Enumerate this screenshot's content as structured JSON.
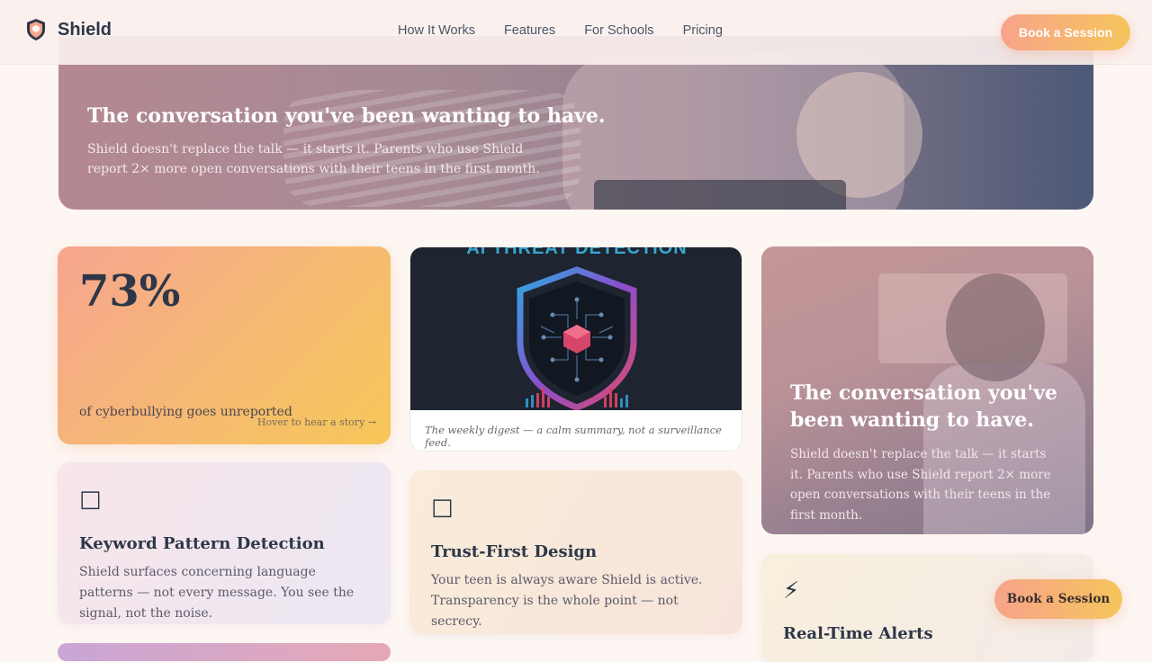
{
  "nav": {
    "brand": "Shield",
    "links": [
      "How It Works",
      "Features",
      "For Schools",
      "Pricing"
    ],
    "cta": "Book a Session"
  },
  "hero": {
    "title": "The conversation you've been wanting to have.",
    "subtitle": "Shield doesn't replace the talk — it starts it. Parents who use Shield report 2× more open conversations with their teens in the first month."
  },
  "stat_card": {
    "value": "73%",
    "label": "of cyberbullying goes unreported",
    "hover_hint": "Hover to hear a story →"
  },
  "image_card": {
    "image_text": "AI THREAT DETECTION",
    "caption": "The weekly digest — a calm summary, not a surveillance feed."
  },
  "photo_card": {
    "title": "The conversation you've been wanting to have.",
    "subtitle": "Shield doesn't replace the talk — it starts it. Parents who use Shield report 2× more open conversations with their teens in the first month."
  },
  "features": [
    {
      "icon": "missing-glyph-icon",
      "glyph": "□",
      "title": "Keyword Pattern Detection",
      "desc": "Shield surfaces concerning language patterns — not every message. You see the signal, not the noise."
    },
    {
      "icon": "missing-glyph-icon",
      "glyph": "□",
      "title": "Trust-First Design",
      "desc": "Your teen is always aware Shield is active. Transparency is the whole point — not secrecy."
    },
    {
      "icon": "lightning-icon",
      "glyph": "⚡",
      "title": "Real-Time Alerts",
      "desc": ""
    }
  ],
  "floating_cta": "Book a Session",
  "colors": {
    "accent_start": "#f7a38a",
    "accent_end": "#f6c55c",
    "text_dark": "#2d3748",
    "background": "#fdf6f2"
  }
}
